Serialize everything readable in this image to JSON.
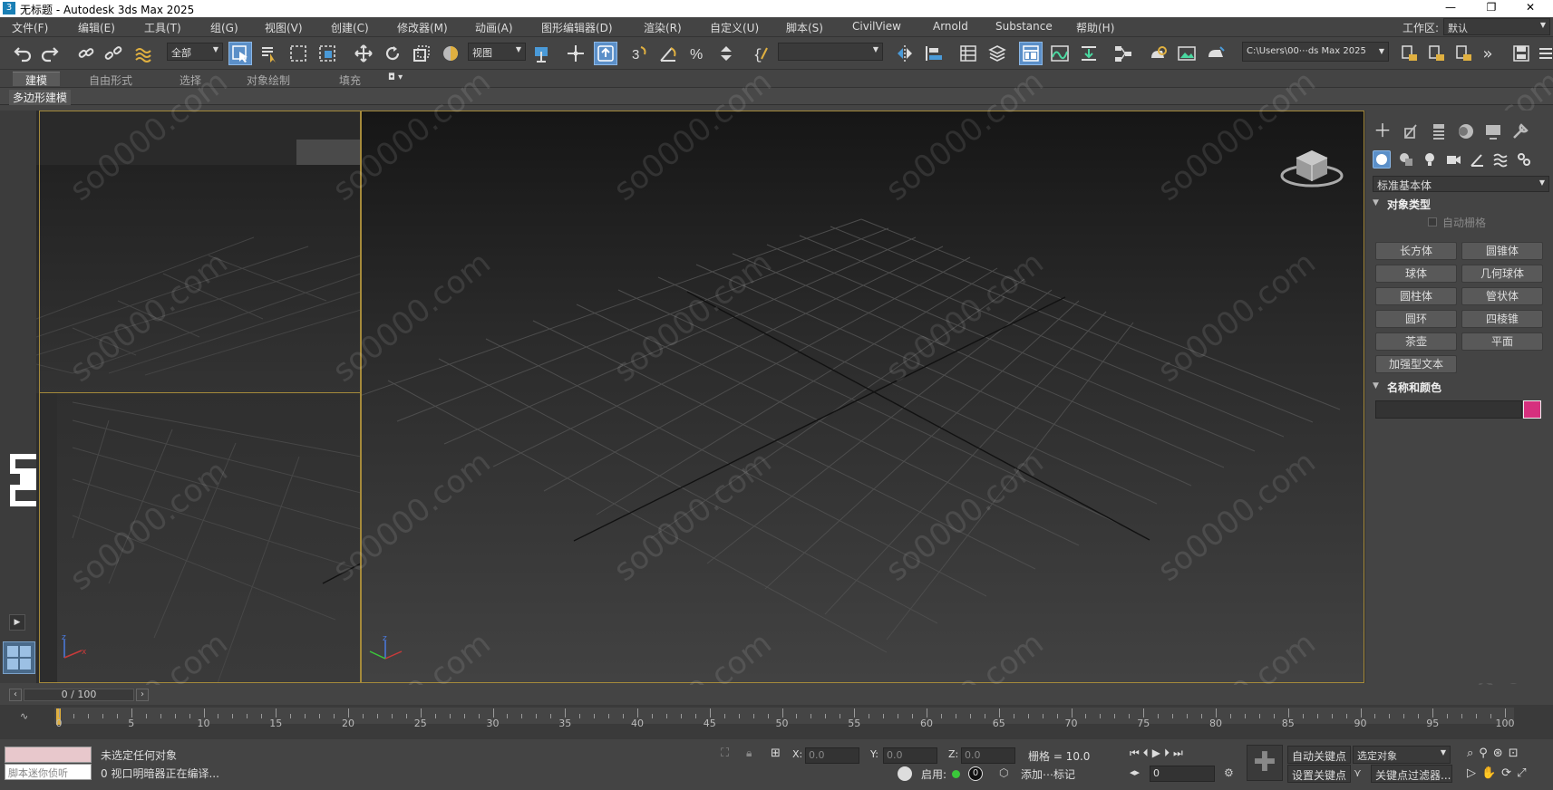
{
  "window": {
    "title": "无标题 - Autodesk 3ds Max 2025",
    "app_icon": "3",
    "controls": [
      "—",
      "❐",
      "✕"
    ]
  },
  "menu": {
    "items": [
      "文件(F)",
      "编辑(E)",
      "工具(T)",
      "组(G)",
      "视图(V)",
      "创建(C)",
      "修改器(M)",
      "动画(A)",
      "图形编辑器(D)",
      "渲染(R)",
      "自定义(U)",
      "脚本(S)",
      "CivilView",
      "Arnold",
      "Substance",
      "帮助(H)"
    ],
    "workspace_label": "工作区:",
    "workspace_value": "默认"
  },
  "toolbar": {
    "selection_filter": "全部",
    "ref_coord": "视图",
    "named_selection": "",
    "project_path": "C:\\Users\\00⋯ds Max 2025"
  },
  "ribbon": {
    "tabs": [
      "建模",
      "自由形式",
      "选择",
      "对象绘制",
      "填充"
    ],
    "subtab": "多边形建模"
  },
  "command_panel": {
    "category": "标准基本体",
    "object_type_title": "对象类型",
    "autogrid": "自动栅格",
    "buttons": [
      "长方体",
      "圆锥体",
      "球体",
      "几何球体",
      "圆柱体",
      "管状体",
      "圆环",
      "四棱锥",
      "茶壶",
      "平面",
      "加强型文本"
    ],
    "name_color_title": "名称和颜色",
    "object_color": "#d6307e"
  },
  "time": {
    "frame_display": "0 / 100",
    "ticks": [
      "0",
      "5",
      "10",
      "15",
      "20",
      "25",
      "30",
      "35",
      "40",
      "45",
      "50",
      "55",
      "60",
      "65",
      "70",
      "75",
      "80",
      "85",
      "90",
      "95",
      "100"
    ]
  },
  "status": {
    "maxscript_placeholder": "脚本迷你侦听",
    "selection_msg": "未选定任何对象",
    "prompt_msg": "0 视口明暗器正在编译...",
    "x_label": "X:",
    "y_label": "Y:",
    "z_label": "Z:",
    "x_val": "0.0",
    "y_val": "0.0",
    "z_val": "0.0",
    "grid": "栅格 = 10.0",
    "enable_label": "启用:",
    "enable_count": "0",
    "add_tag": "添加⋯标记",
    "auto_key": "自动关键点",
    "set_key": "设置关键点",
    "selected_obj": "选定对象",
    "key_filters": "关键点过滤器...",
    "frame_field": "0"
  },
  "watermark": "so0000.com"
}
